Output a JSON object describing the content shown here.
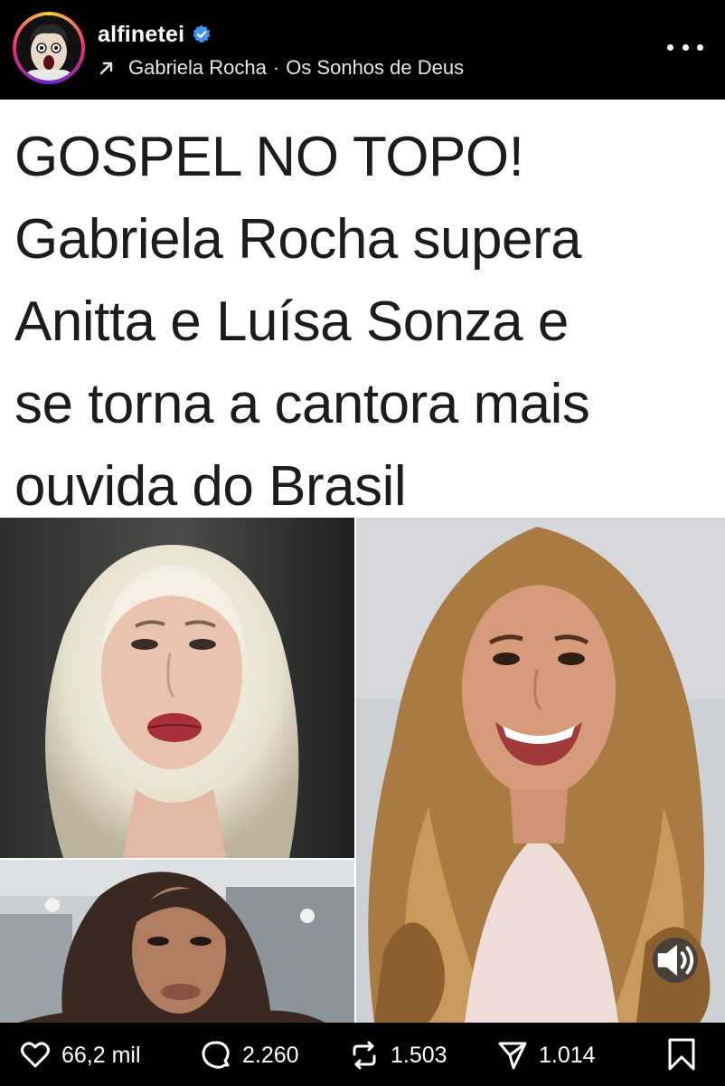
{
  "header": {
    "username": "alfinetei",
    "verified": true,
    "music": {
      "artist": "Gabriela Rocha",
      "separator": "·",
      "track": "Os Sonhos de Deus"
    },
    "icons": {
      "verified": "verified-badge-icon",
      "music": "trending-arrow-icon",
      "more": "more-options-icon"
    }
  },
  "post": {
    "headline": "GOSPEL NO TOPO!\nGabriela Rocha supera\nAnitta e Luísa Sonza e\nse torna a cantora mais\nouvida do Brasil",
    "audio_icon": "volume-icon"
  },
  "actions": {
    "likes": "66,2 mil",
    "comments": "2.260",
    "reposts": "1.503",
    "shares": "1.014",
    "icons": {
      "like": "heart-icon",
      "comment": "comment-icon",
      "repost": "repost-icon",
      "share": "share-icon",
      "save": "bookmark-icon"
    }
  },
  "colors": {
    "background": "#000000",
    "verified": "#3897f0",
    "headline_text": "#1c1c1c"
  }
}
